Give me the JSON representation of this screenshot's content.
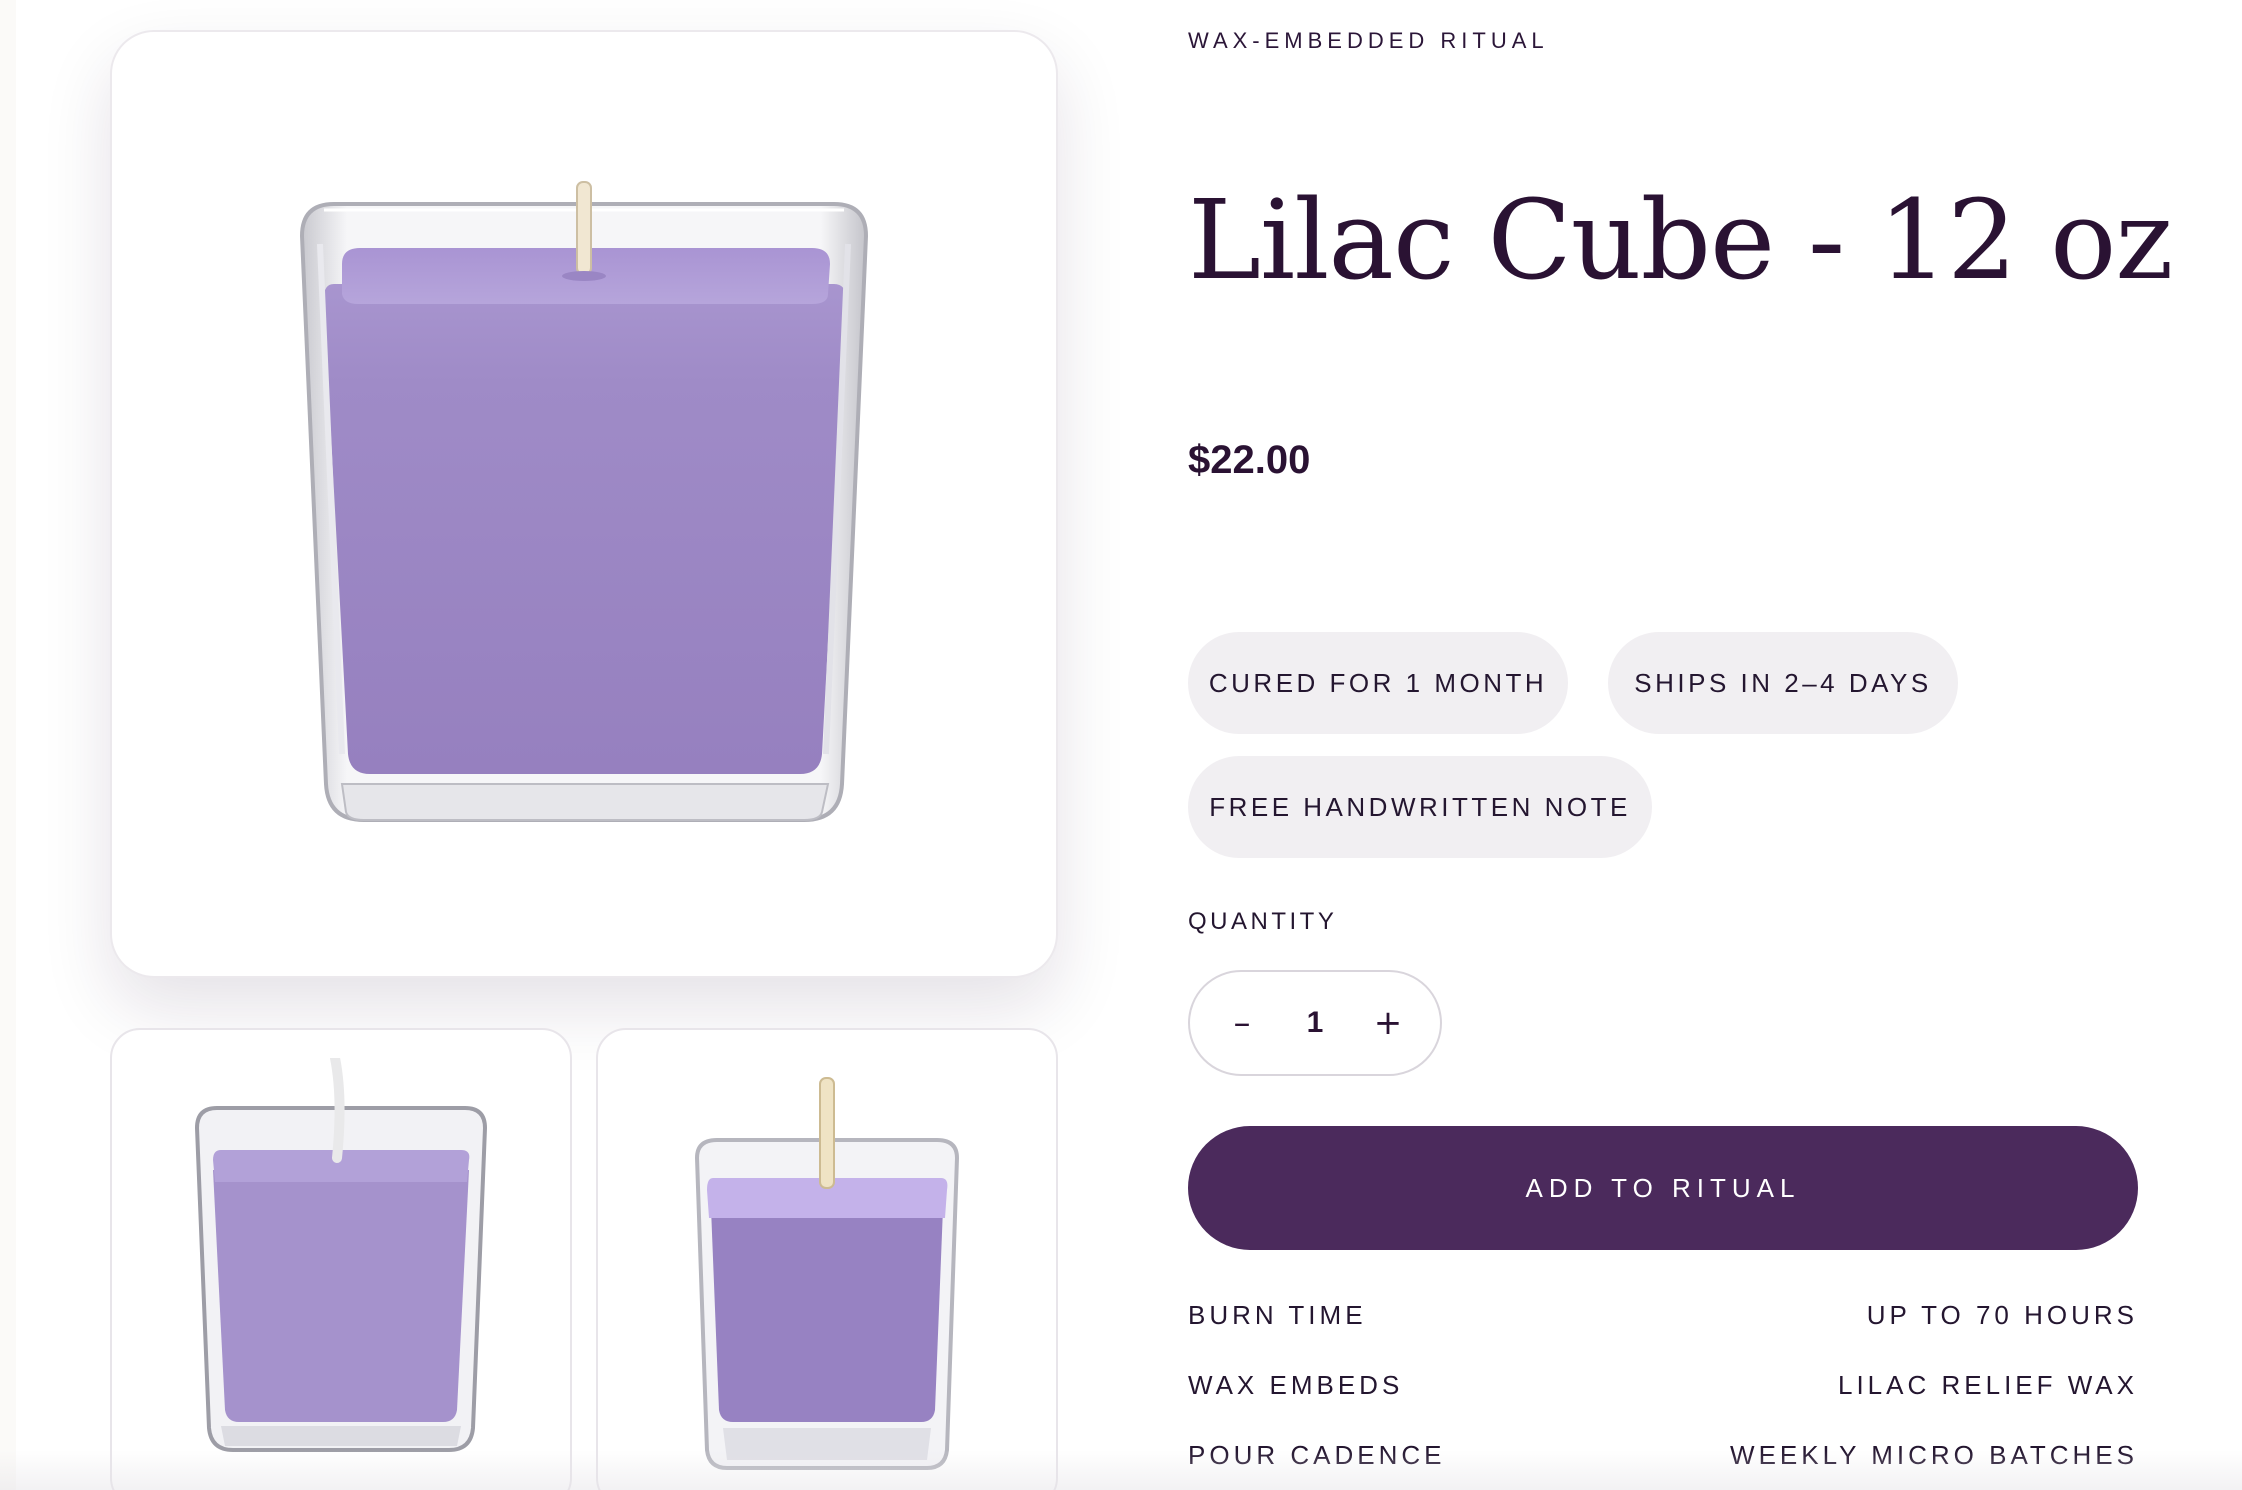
{
  "product": {
    "eyebrow": "WAX-EMBEDDED RITUAL",
    "title": "Lilac Cube - 12 oz",
    "price": "$22.00"
  },
  "badges": [
    {
      "label": "CURED FOR 1 MONTH"
    },
    {
      "label": "SHIPS IN 2–4 DAYS"
    },
    {
      "label": "FREE HANDWRITTEN NOTE"
    }
  ],
  "quantity": {
    "label": "QUANTITY",
    "value": "1",
    "decrement_symbol": "–",
    "increment_symbol": "+"
  },
  "cta": {
    "label": "ADD TO RITUAL"
  },
  "specs": [
    {
      "label": "BURN TIME",
      "value": "UP TO 70 HOURS"
    },
    {
      "label": "WAX EMBEDS",
      "value": "LILAC RELIEF WAX"
    },
    {
      "label": "POUR CADENCE",
      "value": "WEEKLY MICRO BATCHES"
    }
  ],
  "gallery": {
    "main_image": "lilac-cube-candle-image",
    "thumbnails": [
      "lilac-cube-candle-thumbnail",
      "lilac-cube-candle-thumbnail-alt"
    ]
  },
  "colors": {
    "accent": "#4b2a5c",
    "wax_lilac": "#9e88c4",
    "pill_bg": "#f1eff2",
    "text": "#2a1233"
  }
}
